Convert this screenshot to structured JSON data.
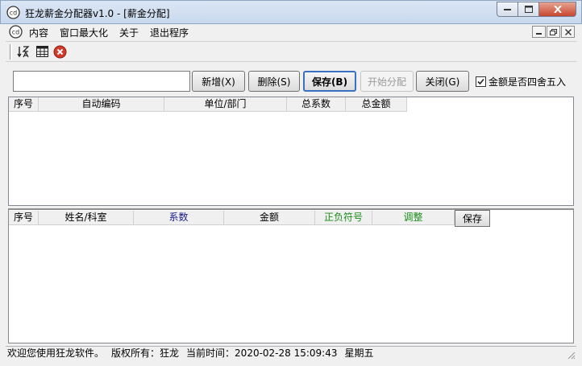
{
  "window": {
    "title": "狂龙薪金分配器v1.0 - [薪金分配]"
  },
  "menu": {
    "items": [
      "内容",
      "窗口最大化",
      "关于",
      "退出程序"
    ]
  },
  "toolbar": {
    "icons": [
      "sort-az-icon",
      "grid-icon",
      "stop-icon"
    ]
  },
  "form": {
    "name_value": "",
    "buttons": {
      "add": "新增(X)",
      "delete": "删除(S)",
      "save": "保存(B)",
      "start": "开始分配",
      "close": "关闭(G)"
    },
    "round_label": "金额是否四舍五入",
    "round_checked": true
  },
  "units_table": {
    "columns": [
      "序号",
      "自动编码",
      "单位/部门",
      "总系数",
      "总金额"
    ],
    "rows": []
  },
  "people_table": {
    "columns": [
      "序号",
      "姓名/科室",
      "系数",
      "金额",
      "正负符号",
      "调整"
    ],
    "save_label": "保存",
    "rows": []
  },
  "status": {
    "welcome": "欢迎您使用狂龙软件。",
    "copyright": "版权所有：狂龙",
    "time_label": "当前时间：",
    "time_value": "2020-02-28 15:09:43",
    "weekday": "星期五"
  },
  "colors": {
    "coef_header": "#1a1a8c",
    "sign_header": "#1a8c1a",
    "adjust_header": "#1a8c1a",
    "close_button": "#c7462f"
  }
}
